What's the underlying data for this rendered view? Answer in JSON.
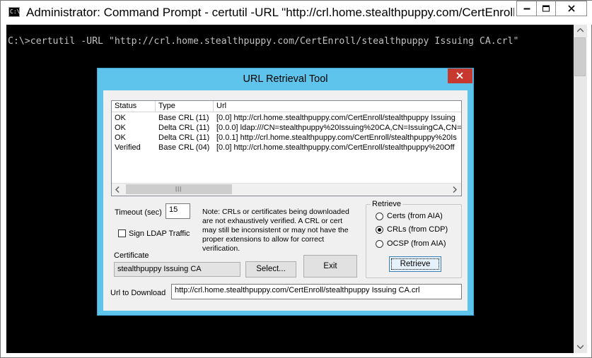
{
  "console_window": {
    "title": "Administrator: Command Prompt - certutil  -URL \"http://crl.home.stealthpuppy.com/CertEnroll/stealthp...",
    "icon_text": "C:\\",
    "lines": [
      "C:\\>certutil -URL \"http://crl.home.stealthpuppy.com/CertEnroll/stealthpuppy Issuing CA.crl\""
    ],
    "caption_buttons": [
      "minimize",
      "maximize",
      "close"
    ]
  },
  "dialog": {
    "title": "URL Retrieval Tool",
    "list": {
      "columns": [
        "Status",
        "Type",
        "Url"
      ],
      "rows": [
        {
          "status": "OK",
          "type": "Base CRL (11)",
          "url": "[0.0] http://crl.home.stealthpuppy.com/CertEnroll/stealthpuppy Issuing"
        },
        {
          "status": "OK",
          "type": "Delta CRL (11)",
          "url": "[0.0.0] ldap:///CN=stealthpuppy%20Issuing%20CA,CN=IssuingCA,CN="
        },
        {
          "status": "OK",
          "type": "Delta CRL (11)",
          "url": "[0.0.1] http://crl.home.stealthpuppy.com/CertEnroll/stealthpuppy%20Is"
        },
        {
          "status": "Verified",
          "type": "Base CRL (04)",
          "url": "[0.0] http://crl.home.stealthpuppy.com/CertEnroll/stealthpuppy%20Off"
        }
      ],
      "scroll_grip": "|||"
    },
    "timeout_label": "Timeout (sec)",
    "timeout_value": "15",
    "sign_ldap_label": "Sign LDAP Traffic",
    "note_lines": [
      "Note: CRLs or certificates being downloaded",
      "are not exhaustively verified.  A CRL or cert",
      "may still be inconsistent or may not have the",
      "proper extensions to allow for correct",
      "verification."
    ],
    "certificate_label": "Certificate",
    "certificate_value": "stealthpuppy Issuing CA",
    "select_button": "Select...",
    "exit_button": "Exit",
    "retrieve_group_label": "Retrieve",
    "retrieve_options": [
      {
        "label": "Certs (from AIA)",
        "selected": false
      },
      {
        "label": "CRLs (from CDP)",
        "selected": true
      },
      {
        "label": "OCSP (from AIA)",
        "selected": false
      }
    ],
    "retrieve_button": "Retrieve",
    "url_label": "Url to Download",
    "url_value": "http://crl.home.stealthpuppy.com/CertEnroll/stealthpuppy Issuing CA.crl"
  },
  "colors": {
    "dialog_frame": "#5fc4ec",
    "close_button": "#c7392e",
    "console_background": "#000000",
    "console_text": "#c0c0c0"
  }
}
